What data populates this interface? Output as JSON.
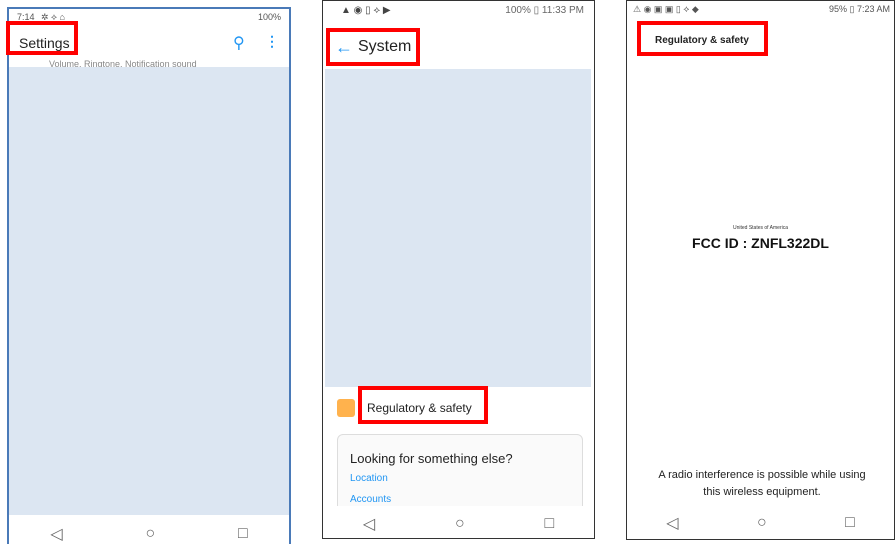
{
  "panel1": {
    "status_time": "7:14",
    "status_icons_left": "✲ ⟡ ⌂",
    "status_right": "100%",
    "title": "Settings",
    "subtitle": "Volume, Ringtone, Notification sound"
  },
  "panel2": {
    "status_icons_left": "▲ ◉ ▯ ⟡ ▶",
    "status_right": "100% ▯ 11:33 PM",
    "title": "System",
    "list_item": "Regulatory & safety",
    "card_heading": "Looking for something else?",
    "card_links": [
      "Location",
      "Accounts"
    ]
  },
  "panel3": {
    "status_icons_left": "⚠ ◉ ▣ ▣ ▯ ⟡ ◆",
    "status_right": "95% ▯ 7:23 AM",
    "title": "Regulatory & safety",
    "country": "United States of America",
    "fcc": "FCC ID : ZNFL322DL",
    "notice": "A radio interference is possible while using this wireless equipment."
  },
  "nav": {
    "back": "◁",
    "home": "○",
    "recent": "□"
  },
  "colors": {
    "highlight": "#ff0000",
    "accent": "#2196f3",
    "placeholder": "#dce6f2"
  }
}
